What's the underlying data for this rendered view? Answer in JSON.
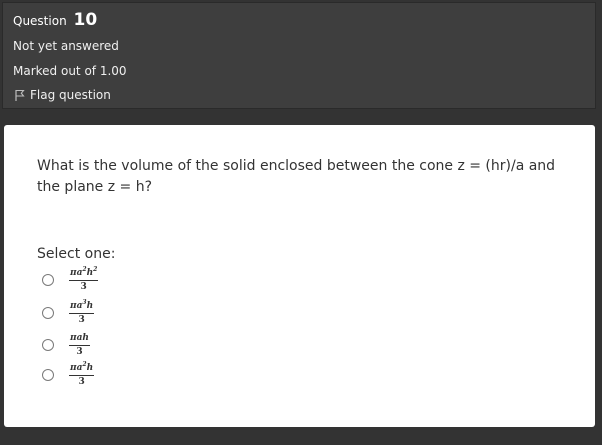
{
  "question": {
    "label": "Question",
    "number": "10",
    "status": "Not yet answered",
    "marks": "Marked out of 1.00",
    "flag_label": "Flag question",
    "flag_icon": "flag-icon",
    "text": "What is the volume of the solid enclosed between the cone z = (hr)/a and the plane z = h?",
    "prompt": "Select one:"
  },
  "answers": [
    {
      "num_html": "πa<sup>2</sup>h<sup>2</sup>",
      "den": "3"
    },
    {
      "num_html": "πa<sup>3</sup>h",
      "den": "3"
    },
    {
      "num_html": "πah",
      "den": "3"
    },
    {
      "num_html": "πa<sup>2</sup>h",
      "den": "3"
    }
  ]
}
